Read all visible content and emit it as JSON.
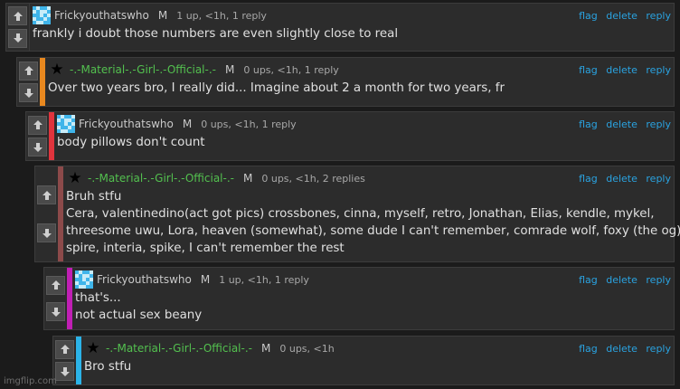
{
  "comments": [
    {
      "username": "Frickyouthatswho",
      "name_color": "#c8c8c8",
      "badge": "M",
      "meta": "1 up, <1h, 1 reply",
      "stripe_color": "",
      "avatar": "pixel-avatar",
      "lines": [
        "frankly i doubt those numbers are even slightly close to real"
      ]
    },
    {
      "username": "-.-Material-.-Girl-.-Official-.-",
      "name_color": "#53c04f",
      "badge": "M",
      "meta": "0 ups, <1h, 1 reply",
      "stripe_color": "#e8881f",
      "avatar": "star-icon",
      "lines": [
        "Over two years bro, I really did... Imagine about 2 a month for two years, fr"
      ]
    },
    {
      "username": "Frickyouthatswho",
      "name_color": "#c8c8c8",
      "badge": "M",
      "meta": "0 ups, <1h, 1 reply",
      "stripe_color": "#e0343d",
      "avatar": "pixel-avatar",
      "lines": [
        "body pillows don't count"
      ]
    },
    {
      "username": "-.-Material-.-Girl-.-Official-.-",
      "name_color": "#53c04f",
      "badge": "M",
      "meta": "0 ups, <1h, 2 replies",
      "stripe_color": "#8c4a4a",
      "avatar": "star-icon",
      "lines": [
        "Bruh stfu",
        "Cera, valentinedino(act got pics) crossbones, cinna, myself, retro, Jonathan, Elias, kendle, mykel,",
        "threesome uwu, Lora, heaven (somewhat), some dude I can't remember, comrade wolf, foxy (the og),",
        "spire, interia, spike, I can't remember the rest"
      ]
    },
    {
      "username": "Frickyouthatswho",
      "name_color": "#c8c8c8",
      "badge": "M",
      "meta": "1 up, <1h, 1 reply",
      "stripe_color": "#c01fb4",
      "avatar": "pixel-avatar",
      "lines": [
        "that's...",
        "not actual sex beany"
      ]
    },
    {
      "username": "-.-Material-.-Girl-.-Official-.-",
      "name_color": "#53c04f",
      "badge": "M",
      "meta": "0 ups, <1h",
      "stripe_color": "#2bb3e8",
      "avatar": "star-icon",
      "lines": [
        "Bro stfu"
      ]
    }
  ],
  "actions": {
    "flag": "flag",
    "delete": "delete",
    "reply": "reply"
  },
  "watermark": "imgflip.com",
  "colors": {
    "link": "#2aa3e1",
    "panel": "#2c2c2c",
    "background": "#1b1b1b"
  }
}
